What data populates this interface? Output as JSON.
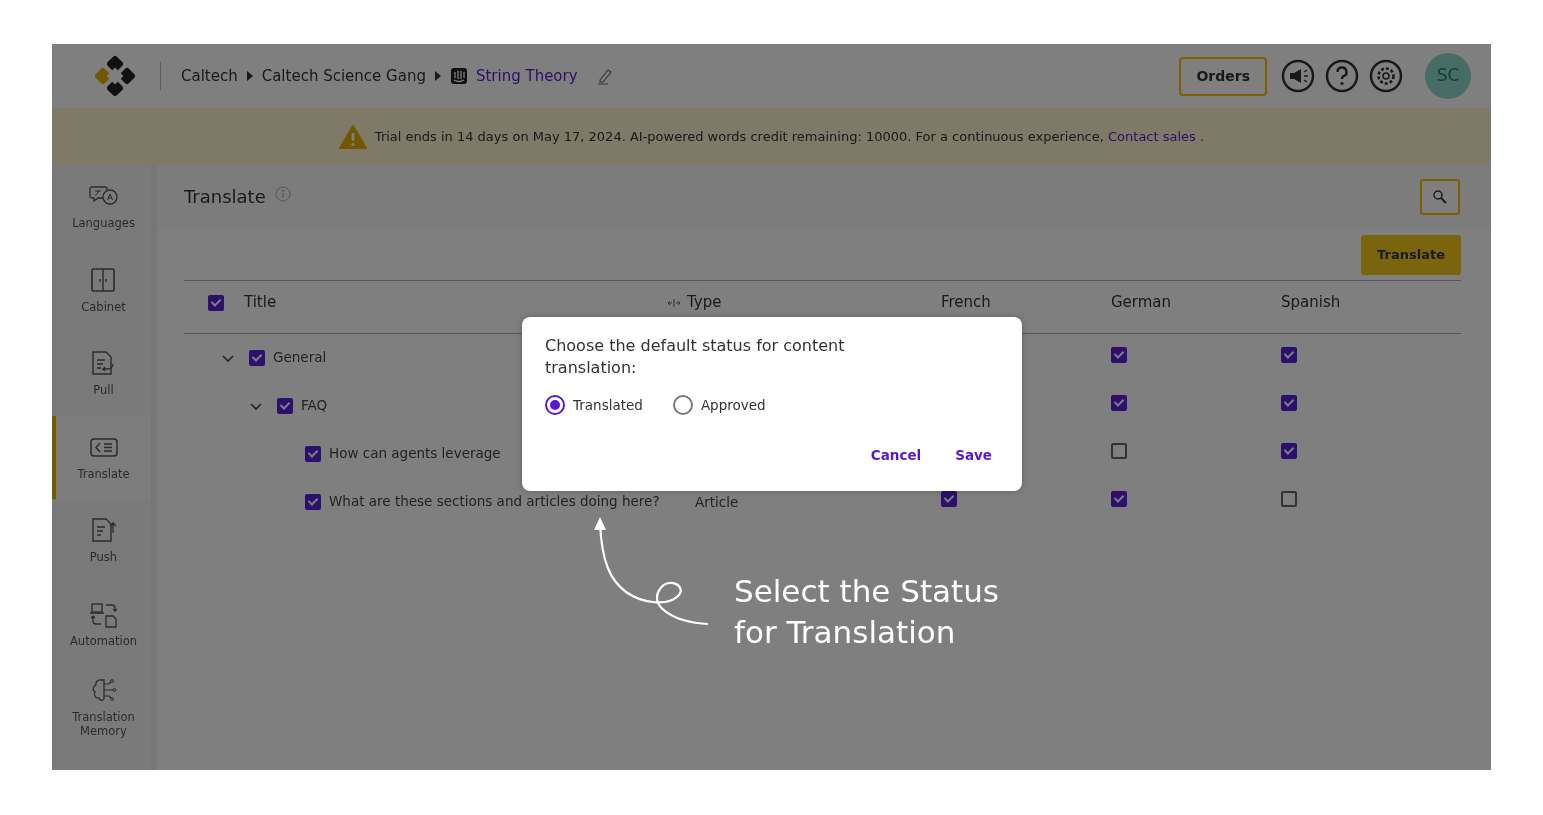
{
  "header": {
    "breadcrumbs": [
      {
        "label": "Caltech",
        "current": false
      },
      {
        "label": "Caltech Science Gang",
        "current": false
      },
      {
        "label": "String Theory",
        "current": true
      }
    ],
    "orders_button": "Orders",
    "avatar": "SC"
  },
  "banner": {
    "text": "Trial ends in 14 days on May 17, 2024. AI-powered words credit remaining: 10000. For a continuous experience,",
    "link": "Contact sales",
    "tail": "."
  },
  "sidebar": {
    "items": [
      {
        "label": "Languages",
        "selected": false
      },
      {
        "label": "Cabinet",
        "selected": false
      },
      {
        "label": "Pull",
        "selected": false
      },
      {
        "label": "Translate",
        "selected": true
      },
      {
        "label": "Push",
        "selected": false
      },
      {
        "label": "Automation",
        "selected": false
      },
      {
        "label": "Translation Memory",
        "selected": false
      }
    ]
  },
  "page": {
    "title": "Translate",
    "translate_button": "Translate"
  },
  "table": {
    "columns": [
      "Title",
      "Type",
      "French",
      "German",
      "Spanish"
    ],
    "header_checked": true,
    "rows": [
      {
        "title": "General",
        "checked": true,
        "expanded": true,
        "german": true,
        "spanish": true,
        "children": [
          {
            "title": "FAQ",
            "checked": true,
            "expanded": true,
            "german": true,
            "spanish": true,
            "children": [
              {
                "title": "How can agents leverage",
                "checked": true,
                "german": false,
                "spanish": true
              },
              {
                "title": "What are these sections and articles doing here?",
                "checked": true,
                "type": "Article",
                "french": true,
                "german": true,
                "spanish": false
              }
            ]
          }
        ]
      }
    ]
  },
  "modal": {
    "question": "Choose the default status for content translation:",
    "options": [
      {
        "label": "Translated",
        "selected": true
      },
      {
        "label": "Approved",
        "selected": false
      }
    ],
    "buttons": [
      "Cancel",
      "Save"
    ]
  },
  "annotation": {
    "lines": [
      "Select the Status",
      "for Translation"
    ]
  }
}
